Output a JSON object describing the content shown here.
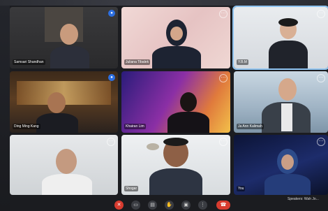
{
  "participants": [
    {
      "name": "Samsari Shandhan",
      "menu_icon": "more-icon"
    },
    {
      "name": "Juliana Tibalek",
      "menu_icon": "more-icon"
    },
    {
      "name": "Y.B.M",
      "menu_icon": "more-icon"
    },
    {
      "name": "Ding Ming Kang",
      "menu_icon": "more-icon"
    },
    {
      "name": "Khairan Lim",
      "menu_icon": "more-icon"
    },
    {
      "name": "Ja Ann Kalimah",
      "menu_icon": "more-icon"
    },
    {
      "name": "",
      "menu_icon": "more-icon"
    },
    {
      "name": "Shogar",
      "menu_icon": "more-icon"
    },
    {
      "name": "You",
      "menu_icon": "more-icon"
    }
  ],
  "active_speaker_badge": "●",
  "toolbar": {
    "icons": [
      "mic-off-icon",
      "camera-icon",
      "captions-icon",
      "raise-hand-icon",
      "present-icon",
      "more-icon",
      "leave-call-icon"
    ],
    "glyphs": [
      "✕",
      "▭",
      "▤",
      "✋",
      "▣",
      "⋮",
      "☎"
    ]
  },
  "caption_text": "Speakers: Wah Jo..."
}
